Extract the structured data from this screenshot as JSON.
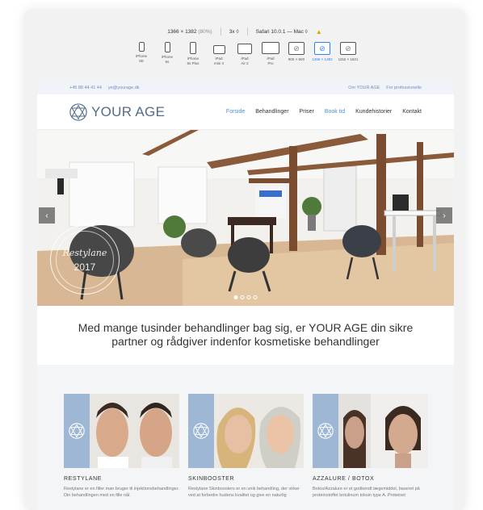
{
  "toolbar": {
    "resolution": "1366 × 1382",
    "zoom": "(80%)",
    "scale": "3x",
    "browser": "Safari 10.0.1 — Mac"
  },
  "devices": [
    {
      "label": "iPhone\nSE",
      "icon": "phone-icon"
    },
    {
      "label": "iPhone\n6s",
      "icon": "phone-icon"
    },
    {
      "label": "iPhone\n6s Plus",
      "icon": "phone-icon"
    },
    {
      "label": "iPad\nmini 4",
      "icon": "tablet-icon"
    },
    {
      "label": "iPad\nAir 2",
      "icon": "tablet-icon"
    },
    {
      "label": "iPad\nPro",
      "icon": "tablet-icon"
    },
    {
      "label": "800 × 600",
      "icon": "compass-icon"
    },
    {
      "label": "1366 × 1382",
      "icon": "compass-icon",
      "active": true
    },
    {
      "label": "1152 × 1621",
      "icon": "compass-icon"
    }
  ],
  "site": {
    "topbar": {
      "phone": "+45 88 44 41 44",
      "email": "ye@yourage.dk",
      "links": [
        "Om YOUR AGE",
        "For professionelle"
      ]
    },
    "logo": "YOUR AGE",
    "menu": [
      "Forside",
      "Behandlinger",
      "Priser",
      "Book tid",
      "Kundehistorier",
      "Kontakt"
    ],
    "hero": {
      "stamp_brand": "Restylane",
      "stamp_year": "2017",
      "stamp_ring_text": "RESTYLANE"
    },
    "tagline": "Med mange tusinder behandlinger bag sig, er YOUR AGE din sikre partner og rådgiver indenfor kosmetiske behandlinger",
    "cards": [
      {
        "title": "RESTYLANE",
        "desc": "Restylane er en filler man bruger til injektionsbehandlinger. Din behandlingen med en fille nål."
      },
      {
        "title": "SKINBOOSTER",
        "desc": "Restylane Skinboosters er en unik behandling, der virker ved at forbedre hudens kvalitet og give en naturlig"
      },
      {
        "title": "AZZALURE / BOTOX",
        "desc": "Botox/Azzalure er et godkendt lægemiddel, baseret på proteinstoffet botulinum toksin type A. Proteinet"
      }
    ],
    "colors": {
      "accent": "#4a8fd6",
      "brand": "#546c86",
      "card_blue": "#9db7d4"
    }
  }
}
